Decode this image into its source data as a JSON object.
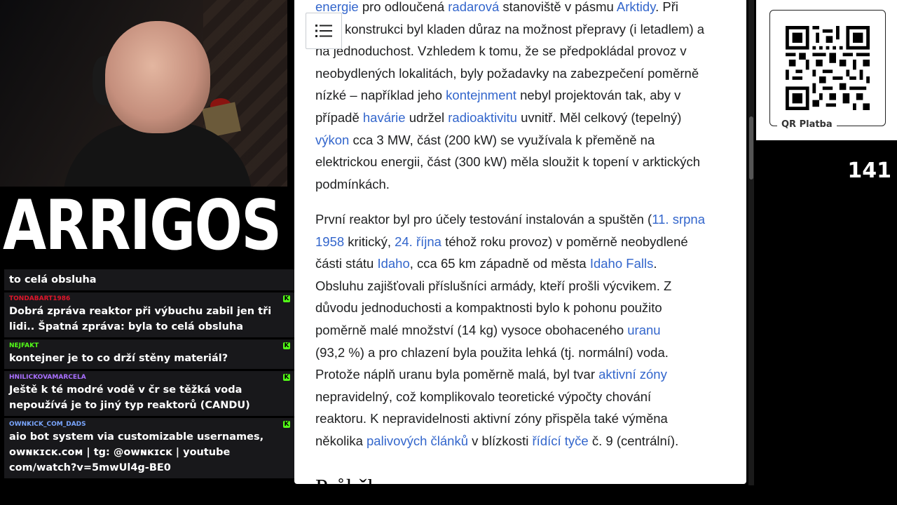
{
  "stream": {
    "logo_text": "ARRIGOS",
    "viewer_count": "141",
    "qr_label": "QR Platba"
  },
  "chat": {
    "messages": [
      {
        "user": "",
        "user_color": "#ffffff",
        "text": "to celá obsluha"
      },
      {
        "user": "TONDABART1986",
        "user_color": "#e0162b",
        "text": "Dobrá zpráva reaktor při výbuchu zabil jen tři lidi.. Špatná zpráva: byla to celá obsluha"
      },
      {
        "user": "NEJFAKT",
        "user_color": "#53fc18",
        "text": "kontejner je to co drží stěny materiál?"
      },
      {
        "user": "HNILICKOVAMARCELA",
        "user_color": "#a970ff",
        "text": "Ještě k té modré vodě v čr se těžká voda nepoužívá je to jiný typ reaktorů (CANDU)"
      },
      {
        "user": "OWNKICK_COM_DADS",
        "user_color": "#7aa6ff",
        "text": "aio bot system via customizable usernames, ᴏᴡɴᴋɪᴄᴋ.ᴄᴏᴍ | tg: @ᴏᴡɴᴋɪᴄᴋ | youtube com/watch?v=5mwUl4g-BE0"
      }
    ]
  },
  "article": {
    "p1": {
      "line1_link1": "energie",
      "line1_t1": " pro odloučená ",
      "line1_link2": "radarová",
      "line1_t2": " stanoviště v pásmu ",
      "line1_link3": "Arktidy",
      "line1_t3": ". Při",
      "line2": "konstrukci byl kladen důraz na možnost přepravy (i letadlem) a",
      "line3": "na jednoduchost. Vzhledem k tomu, že se předpokládal provoz v",
      "line4": "neobydlených lokalitách, byly požadavky na zabezpečení poměrně",
      "line5_t1": "nízké – například jeho ",
      "line5_link": "kontejnment",
      "line5_t2": " nebyl projektován tak, aby v",
      "line6_t1": "případě ",
      "line6_link1": "havárie",
      "line6_t2": " udržel ",
      "line6_link2": "radioaktivitu",
      "line6_t3": " uvnitř. Měl celkový (tepelný)",
      "line7_link": "výkon",
      "line7_t1": " cca 3 MW, část (200 kW) se využívala k přeměně na",
      "line8": "elektrickou energii, část (300 kW) měla sloužit k topení v arktických",
      "line9": "podmínkách."
    },
    "p2": {
      "l1_t1": "První reaktor byl pro účely testování instalován a spuštěn (",
      "l1_link": "11. srpna",
      "l2_link1": "1958",
      "l2_t1": " kritický, ",
      "l2_link2": "24. října",
      "l2_t2": " téhož roku provoz) v poměrně neobydlené",
      "l3_t1": "části státu ",
      "l3_link1": "Idaho",
      "l3_t2": ", cca 65 km západně od města ",
      "l3_link2": "Idaho Falls",
      "l3_t3": ".",
      "l4": "Obsluhu zajišťovali příslušníci armády, kteří prošli výcvikem. Z",
      "l5": "důvodu jednoduchosti a kompaktnosti bylo k pohonu použito",
      "l6_t1": "poměrně malé množství (14 kg) vysoce obohaceného ",
      "l6_link": "uranu",
      "l7": "(93,2 %) a pro chlazení byla použita lehká (tj. normální) voda.",
      "l8_t1": "Protože náplň uranu byla poměrně malá, byl tvar ",
      "l8_link": "aktivní zóny",
      "l9": "nepravidelný, což komplikovalo teoretické výpočty chování",
      "l10": "reaktoru. K nepravidelnosti aktivní zóny přispěla také výměna",
      "l11_t1": "několika ",
      "l11_link1": "palivových článků",
      "l11_t2": " v blízkosti ",
      "l11_link2": "řídící tyče",
      "l11_t3": " č. 9 (centrální)."
    },
    "next_heading": "Průběh"
  }
}
